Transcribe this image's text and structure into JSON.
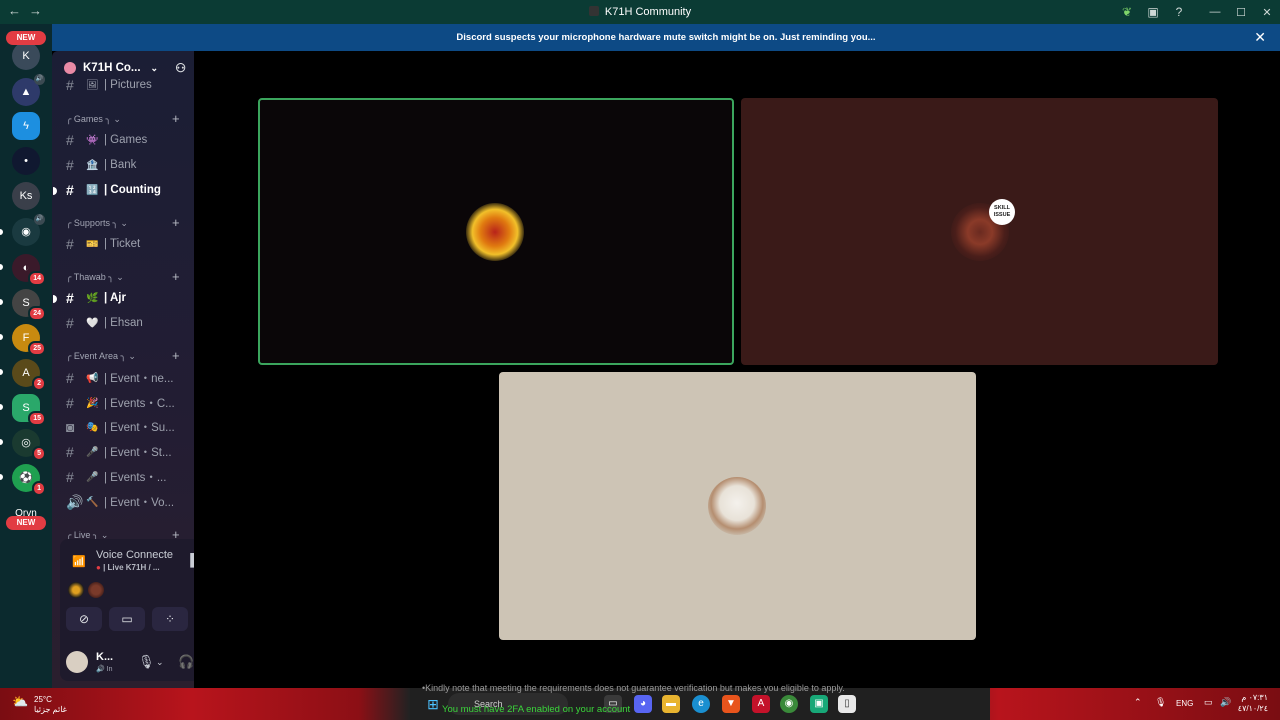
{
  "window": {
    "title": "K71H Community",
    "back_glyph": "←",
    "forward_glyph": "→"
  },
  "notice": {
    "text": "Discord suspects your microphone hardware mute switch might be on. Just reminding you...",
    "close": "✕"
  },
  "server_bar": {
    "new_label_top": "NEW",
    "new_label_bottom": "NEW",
    "text_server": "Ks",
    "orvn_label": "Orvn",
    "badges": [
      "14",
      "24",
      "25",
      "2",
      "15",
      "5",
      "1"
    ]
  },
  "guild": {
    "name": "K71H Co...",
    "chevron": "⌄",
    "invite_icon": "👤+"
  },
  "channels": {
    "partial_top": "| Pictures",
    "categories": [
      {
        "label": "Games",
        "add": "+"
      },
      {
        "label": "Supports",
        "add": "+"
      },
      {
        "label": "Thawab",
        "add": "+"
      },
      {
        "label": "Event Area",
        "add": "+"
      },
      {
        "label": "Live",
        "add": "+"
      }
    ],
    "items": [
      {
        "emoji": "👾",
        "label": "| Games"
      },
      {
        "emoji": "🏦",
        "label": "| Bank"
      },
      {
        "emoji": "🔢",
        "label": "| Counting"
      },
      {
        "emoji": "🎫",
        "label": "| Ticket"
      },
      {
        "emoji": "🌿",
        "label": "| Ajr"
      },
      {
        "emoji": "🤍",
        "label": "| Ehsan"
      },
      {
        "emoji": "📢",
        "label": "| Event・ne..."
      },
      {
        "emoji": "🎉",
        "label": "| Events・C..."
      },
      {
        "emoji": "🎭",
        "label": "| Event・Su..."
      },
      {
        "emoji": "🎤",
        "label": "| Event・St..."
      },
      {
        "emoji": "🎤",
        "label": "| Events・..."
      },
      {
        "emoji": "🔨",
        "label": "| Event・Vo..."
      }
    ]
  },
  "voice": {
    "status": "Voice Connecte",
    "channel": "| Live K71H / ..."
  },
  "user": {
    "name": "K...",
    "status": "In"
  },
  "taskbar": {
    "temperature": "25°C",
    "weather_desc": "غائم جزئيا",
    "search_label": "Search",
    "lang": "ENG",
    "time": "٠٧:٣١ م",
    "date": "٤٧/١٠/٢٤"
  },
  "overlay": {
    "line1": "•Kindly note that meeting the requirements does not guarantee verification but makes you eligible to apply.",
    "line2": "You must have 2FA enabled on your account"
  },
  "colors": {
    "speaking_border": "#3ba55d",
    "tile1_bg": "#0a0608",
    "tile2_bg": "#3a1a18",
    "tile3_bg": "#cdc4b5",
    "notice_bg": "#0d4a85"
  }
}
